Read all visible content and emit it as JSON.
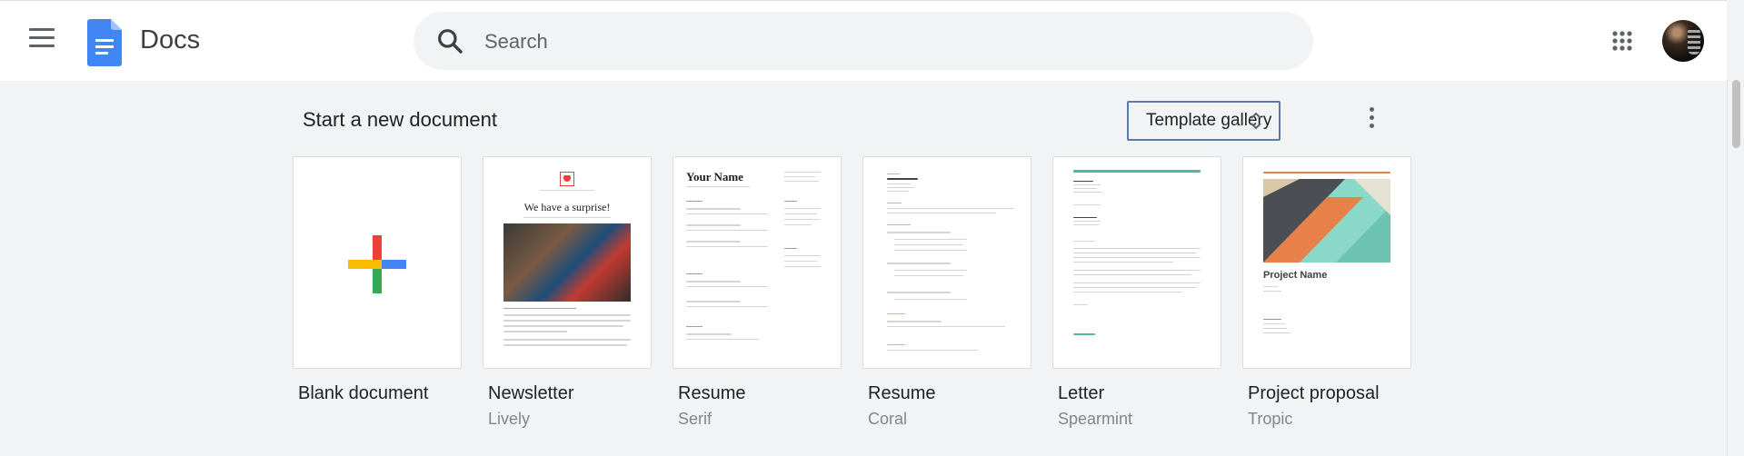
{
  "header": {
    "app_title": "Docs",
    "search_placeholder": "Search"
  },
  "section": {
    "title": "Start a new document",
    "template_gallery_label": "Template gallery"
  },
  "templates": [
    {
      "name": "Blank document",
      "subtitle": ""
    },
    {
      "name": "Newsletter",
      "subtitle": "Lively",
      "thumb_heading": "We have a surprise!"
    },
    {
      "name": "Resume",
      "subtitle": "Serif",
      "thumb_heading": "Your Name"
    },
    {
      "name": "Resume",
      "subtitle": "Coral"
    },
    {
      "name": "Letter",
      "subtitle": "Spearmint"
    },
    {
      "name": "Project proposal",
      "subtitle": "Tropic",
      "thumb_heading": "Project Name"
    }
  ],
  "colors": {
    "brand_blue": "#4285f4",
    "google_red": "#ea4335",
    "google_yellow": "#fbbc04",
    "google_green": "#34a853",
    "page_bg": "#f1f3f4",
    "focus_border": "#5a7baa",
    "spearmint_accent": "#4fb6a3",
    "coral_accent": "#f4a38d"
  }
}
